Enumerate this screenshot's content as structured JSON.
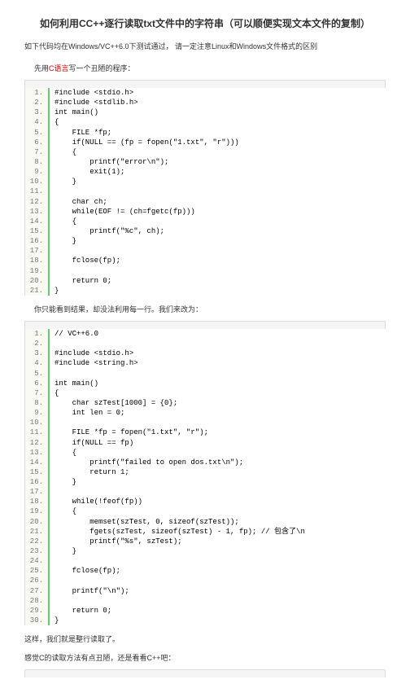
{
  "title": "如何利用CC++逐行读取txt文件中的字符串（可以顺便实现文本文件的复制）",
  "subtitle_pre": "如下代码均在Windows/VC++6.0下测试通过，  请一定注意Linux和Windows文件格式的区别",
  "para1_pre": "先用",
  "para1_red": "C语言",
  "para1_post": "写一个丑陋的程序：",
  "code1": [
    "#include <stdio.h>",
    "#include <stdlib.h>",
    "int main()",
    "{",
    "    FILE *fp;",
    "    if(NULL == (fp = fopen(\"1.txt\", \"r\")))",
    "    {",
    "        printf(\"error\\n\");",
    "        exit(1);",
    "    }",
    "",
    "    char ch;",
    "    while(EOF != (ch=fgetc(fp)))",
    "    {",
    "        printf(\"%c\", ch);",
    "    }",
    "",
    "    fclose(fp);",
    "",
    "    return 0;",
    "}"
  ],
  "para2": "你只能看到结果，却没法利用每一行。我们来改为：",
  "code2": [
    "// VC++6.0",
    "",
    "#include <stdio.h>",
    "#include <string.h>",
    "",
    "int main()",
    "{",
    "    char szTest[1000] = {0};",
    "    int len = 0;",
    "",
    "    FILE *fp = fopen(\"1.txt\", \"r\");",
    "    if(NULL == fp)",
    "    {",
    "        printf(\"failed to open dos.txt\\n\");",
    "        return 1;",
    "    }",
    "",
    "    while(!feof(fp))",
    "    {",
    "        memset(szTest, 0, sizeof(szTest));",
    "        fgets(szTest, sizeof(szTest) - 1, fp); // 包含了\\n",
    "        printf(\"%s\", szTest);",
    "    }",
    "",
    "    fclose(fp);",
    "",
    "    printf(\"\\n\");",
    "",
    "    return 0;",
    "}"
  ],
  "para3": "这样，我们就是整行读取了。",
  "para4": "感觉C的读取方法有点丑陋，还是看看C++吧："
}
